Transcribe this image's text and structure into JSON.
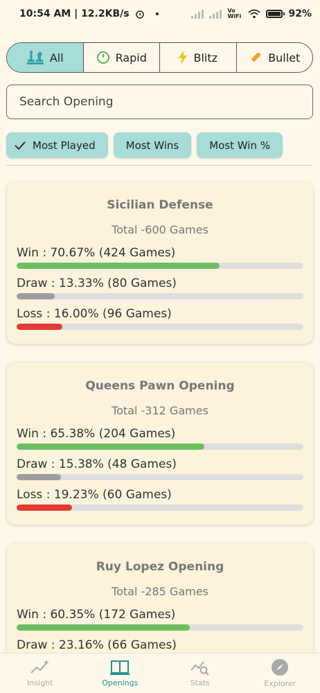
{
  "status": {
    "time": "10:54 AM | 12.2KB/s",
    "net": "Vo WiFi",
    "battery": "92%"
  },
  "tabs": [
    {
      "label": "All",
      "icon": "chess-pieces-icon",
      "active": true
    },
    {
      "label": "Rapid",
      "icon": "clock-icon",
      "active": false
    },
    {
      "label": "Blitz",
      "icon": "lightning-icon",
      "active": false
    },
    {
      "label": "Bullet",
      "icon": "bullet-icon",
      "active": false
    }
  ],
  "search": {
    "placeholder": "Search Opening",
    "value": ""
  },
  "sort_chips": [
    {
      "label": "Most Played",
      "selected": true
    },
    {
      "label": "Most Wins",
      "selected": false
    },
    {
      "label": "Most Win %",
      "selected": false
    }
  ],
  "colors": {
    "win": "#6bbf60",
    "draw": "#9e9e9e",
    "loss": "#e53935",
    "accent": "#a7dcd7",
    "nav_active": "#2a8d92"
  },
  "openings": [
    {
      "name": "Sicilian Defense",
      "total": "Total -600 Games",
      "win": {
        "label": "Win : 70.67% (424 Games)",
        "pct": 70.67
      },
      "draw": {
        "label": "Draw : 13.33% (80 Games)",
        "pct": 13.33
      },
      "loss": {
        "label": "Loss : 16.00% (96 Games)",
        "pct": 16.0
      }
    },
    {
      "name": "Queens Pawn Opening",
      "total": "Total -312 Games",
      "win": {
        "label": "Win : 65.38% (204 Games)",
        "pct": 65.38
      },
      "draw": {
        "label": "Draw : 15.38% (48 Games)",
        "pct": 15.38
      },
      "loss": {
        "label": "Loss : 19.23% (60 Games)",
        "pct": 19.23
      }
    },
    {
      "name": "Ruy Lopez Opening",
      "total": "Total -285 Games",
      "win": {
        "label": "Win : 60.35% (172 Games)",
        "pct": 60.35
      },
      "draw": {
        "label": "Draw : 23.16% (66 Games)",
        "pct": 23.16
      },
      "loss": {
        "label": "",
        "pct": 0
      }
    }
  ],
  "nav": [
    {
      "label": "Insight",
      "icon": "insight-icon",
      "active": false
    },
    {
      "label": "Openings",
      "icon": "book-icon",
      "active": true
    },
    {
      "label": "Stats",
      "icon": "stats-icon",
      "active": false
    },
    {
      "label": "Explorer",
      "icon": "compass-icon",
      "active": false
    }
  ]
}
